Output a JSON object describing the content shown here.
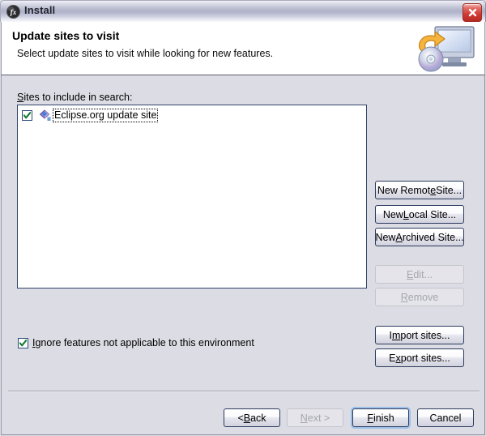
{
  "window": {
    "title": "Install",
    "icon": "install-fx-icon",
    "close_label": "Close"
  },
  "banner": {
    "title": "Update sites to visit",
    "subtitle": "Select update sites to visit while looking for new features.",
    "icon": "update-monitor-disc-icon"
  },
  "main": {
    "list_label_prefix": "",
    "list_label_mnemonic": "S",
    "list_label_rest": "ites to include in search:",
    "sites": [
      {
        "label": "Eclipse.org update site",
        "checked": true,
        "icon": "update-site-icon",
        "focused": true
      }
    ]
  },
  "side_buttons": [
    {
      "id": "new-remote-site",
      "pre": "New Remot",
      "mnemonic": "e",
      "post": " Site...",
      "enabled": true
    },
    {
      "id": "new-local-site",
      "pre": "New ",
      "mnemonic": "L",
      "post": "ocal Site...",
      "enabled": true
    },
    {
      "id": "new-archived-site",
      "pre": "New ",
      "mnemonic": "A",
      "post": "rchived Site...",
      "enabled": true
    },
    {
      "id": "edit",
      "pre": "",
      "mnemonic": "E",
      "post": "dit...",
      "enabled": false
    },
    {
      "id": "remove",
      "pre": "",
      "mnemonic": "R",
      "post": "emove",
      "enabled": false
    },
    {
      "id": "import-sites",
      "pre": "I",
      "mnemonic": "m",
      "post": "port sites...",
      "enabled": true
    },
    {
      "id": "export-sites",
      "pre": "E",
      "mnemonic": "x",
      "post": "port sites...",
      "enabled": true
    }
  ],
  "ignore_option": {
    "pre": "",
    "mnemonic": "I",
    "post": "gnore features not applicable to this environment",
    "checked": true
  },
  "footer_buttons": [
    {
      "id": "back",
      "pre": "< ",
      "mnemonic": "B",
      "post": "ack",
      "enabled": true,
      "default": false
    },
    {
      "id": "next",
      "pre": "",
      "mnemonic": "N",
      "post": "ext >",
      "enabled": false,
      "default": false
    },
    {
      "id": "finish",
      "pre": "",
      "mnemonic": "F",
      "post": "inish",
      "enabled": true,
      "default": true
    },
    {
      "id": "cancel",
      "pre": "Cancel",
      "mnemonic": "",
      "post": "",
      "enabled": true,
      "default": false
    }
  ],
  "colors": {
    "dialog_bg": "#dcdce4",
    "banner_bg": "#ffffff",
    "list_border": "#33436b",
    "button_border": "#2b3a5e",
    "default_ring": "#9cc0e8",
    "close_red": "#cf3a33",
    "disabled_text": "#a6a6ae"
  }
}
